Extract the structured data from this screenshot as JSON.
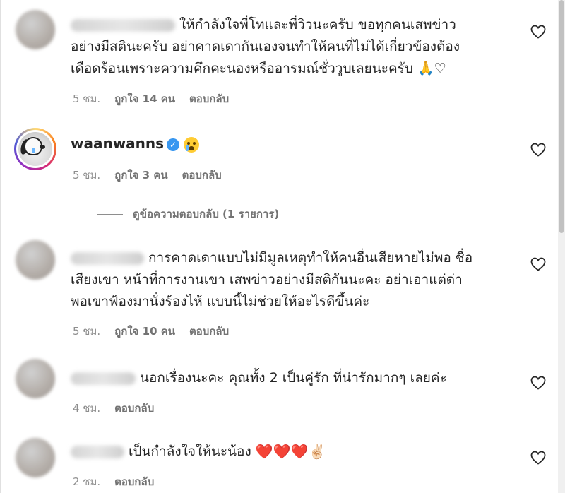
{
  "comments": [
    {
      "text": "ให้กำลังใจพี่โทและพี่วิวนะครับ ขอทุกคนเสพข่าวอย่างมีสตินะครับ อย่าคาดเดากันเองจนทำให้คนที่ไม่ได้เกี่ยวข้องต้องเดือดร้อนเพราะความคึกคะนองหรืออารมณ์ชั่ววูบเลยนะครับ",
      "line1": "ให้กำลังใจพี่โทและพี่วิวนะครับ ขอทุกคนเสพข่าว",
      "line2": "อย่างมีสตินะครับ อย่าคาดเดากันเองจนทำให้คนที่ไม่ได้เกี่ยวข้องต้อง",
      "line3": "เดือดร้อนเพราะความคึกคะนองหรืออารมณ์ชั่ววูบเลยนะครับ",
      "emoji": "🙏♡",
      "time": "5 ชม.",
      "likes": "ถูกใจ 14 คน",
      "reply": "ตอบกลับ"
    },
    {
      "username": "waanwanns",
      "time": "5 ชม.",
      "likes": "ถูกใจ 3 คน",
      "reply": "ตอบกลับ"
    },
    {
      "line1": "การคาดเดาแบบไม่มีมูลเหตุทำให้คนอื่นเสียหายไม่พอ ชื่อ",
      "line2": "เสียงเขา หน้าที่การงานเขา เสพข่าวอย่างมีสติกันนะคะ อย่าเอาแต่ด่า",
      "line3": "พอเขาฟ้องมานั่งร้องไห้ แบบนี้ไม่ช่วยให้อะไรดีขึ้นค่ะ",
      "time": "5 ชม.",
      "likes": "ถูกใจ 10 คน",
      "reply": "ตอบกลับ"
    },
    {
      "line1": "นอกเรื่องนะคะ คุณทั้ง 2 เป็นคู่รัก ที่น่ารักมากๆ เลยค่ะ",
      "time": "4 ชม.",
      "reply": "ตอบกลับ"
    },
    {
      "line1": "เป็นกำลังใจให้นะน้อง",
      "emoji": "❤️❤️❤️✌🏻",
      "time": "2 ชม.",
      "reply": "ตอบกลับ"
    }
  ],
  "view_replies": "ดูข้อความตอบกลับ (1 รายการ)",
  "icons": {
    "like": "heart-outline-icon",
    "verified": "verified-badge-icon",
    "crying": "loudly-crying-face-icon"
  },
  "colors": {
    "text": "#262626",
    "meta": "#8e8e8e",
    "verified": "#3897f0",
    "heart": "#e0245e"
  }
}
